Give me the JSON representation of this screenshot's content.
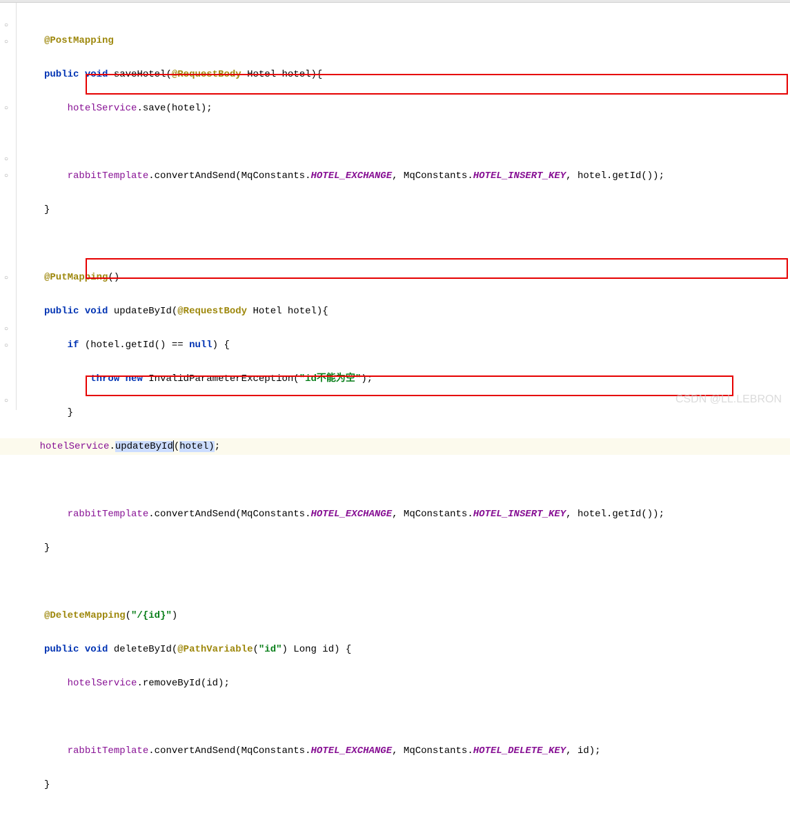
{
  "watermark": "CSDN @LL.LEBRON",
  "code": {
    "l1": "@PostMapping",
    "l2_kw1": "public",
    "l2_kw2": "void",
    "l2_method": " saveHotel(",
    "l2_ann": "@RequestBody",
    "l2_rest": " Hotel hotel){",
    "l3_fld": "hotelService",
    "l3_rest": ".save(hotel);",
    "l4_fld": "rabbitTemplate",
    "l4_m1": ".convertAndSend(MqConstants.",
    "l4_s1": "HOTEL_EXCHANGE",
    "l4_c1": ", MqConstants.",
    "l4_s2": "HOTEL_INSERT_KEY",
    "l4_c2": ", hotel.getId());",
    "l5": "}",
    "l6_ann": "@PutMapping",
    "l6_rest": "()",
    "l7_kw1": "public",
    "l7_kw2": "void",
    "l7_method": " updateById(",
    "l7_ann": "@RequestBody",
    "l7_rest": " Hotel hotel){",
    "l8_kw": "if",
    "l8_c1": " (hotel.getId() == ",
    "l8_kw2": "null",
    "l8_c2": ") {",
    "l9_kw1": "throw",
    "l9_kw2": "new",
    "l9_c1": " InvalidParameterException(",
    "l9_str": "\"id不能为空\"",
    "l9_c2": ");",
    "l10": "}",
    "l11_fld": "hotelService",
    "l11_c1": ".",
    "l11_sel1": "updateById",
    "l11_c2": "(",
    "l11_sel2": "hotel)",
    "l11_c3": ";",
    "l12_fld": "rabbitTemplate",
    "l12_m1": ".convertAndSend(MqConstants.",
    "l12_s1": "HOTEL_EXCHANGE",
    "l12_c1": ", MqConstants.",
    "l12_s2": "HOTEL_INSERT_KEY",
    "l12_c2": ", hotel.getId());",
    "l13": "}",
    "l14_ann": "@DeleteMapping",
    "l14_c1": "(",
    "l14_str": "\"/{id}\"",
    "l14_c2": ")",
    "l15_kw1": "public",
    "l15_kw2": "void",
    "l15_method": " deleteById(",
    "l15_ann": "@PathVariable",
    "l15_c1": "(",
    "l15_str": "\"id\"",
    "l15_c2": ") Long id) {",
    "l16_fld": "hotelService",
    "l16_rest": ".removeById(id);",
    "l17_fld": "rabbitTemplate",
    "l17_m1": ".convertAndSend(MqConstants.",
    "l17_s1": "HOTEL_EXCHANGE",
    "l17_c1": ", MqConstants.",
    "l17_s2": "HOTEL_DELETE_KEY",
    "l17_c2": ", id);",
    "l18": "}"
  }
}
